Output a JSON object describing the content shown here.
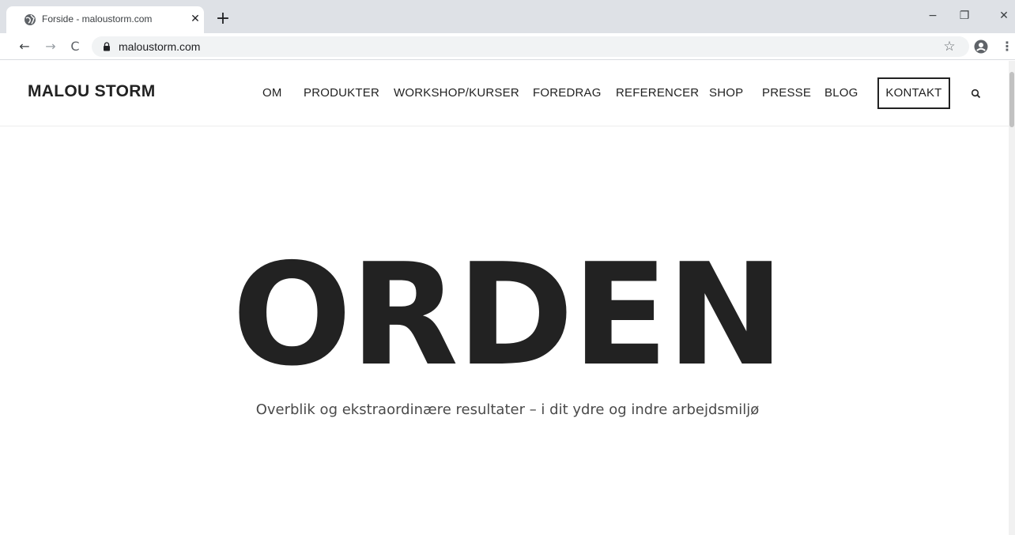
{
  "browser": {
    "tab_title": "Forside - maloustorm.com",
    "tab_close": "✕",
    "new_tab": "+",
    "url": "maloustorm.com",
    "window_minimize": "−",
    "window_restore": "❐",
    "window_close": "✕",
    "nav_back": "←",
    "nav_forward": "→",
    "nav_reload": "C",
    "bookmark_star": "☆",
    "menu": "⋮",
    "icons": {
      "favicon": "globe-icon",
      "lock": "lock-icon",
      "profile": "account-icon"
    }
  },
  "site": {
    "logo": "MALOU STORM",
    "nav": [
      {
        "label": "OM"
      },
      {
        "label": "PRODUKTER"
      },
      {
        "label": "WORKSHOP/KURSER"
      },
      {
        "label": "FOREDRAG"
      },
      {
        "label": "REFERENCER"
      },
      {
        "label": "SHOP"
      },
      {
        "label": "PRESSE"
      },
      {
        "label": "BLOG"
      }
    ],
    "contact_label": "KONTAKT",
    "search_icon": "search-icon"
  },
  "hero": {
    "title": "ORDEN",
    "subtitle": "Overblik og ekstraordinære resultater – i dit ydre og indre arbejdsmiljø"
  },
  "colors": {
    "text_dark": "#222222",
    "subtitle": "#4a4a4a",
    "tabstrip": "#dee1e6",
    "omnibox": "#f1f3f4"
  }
}
